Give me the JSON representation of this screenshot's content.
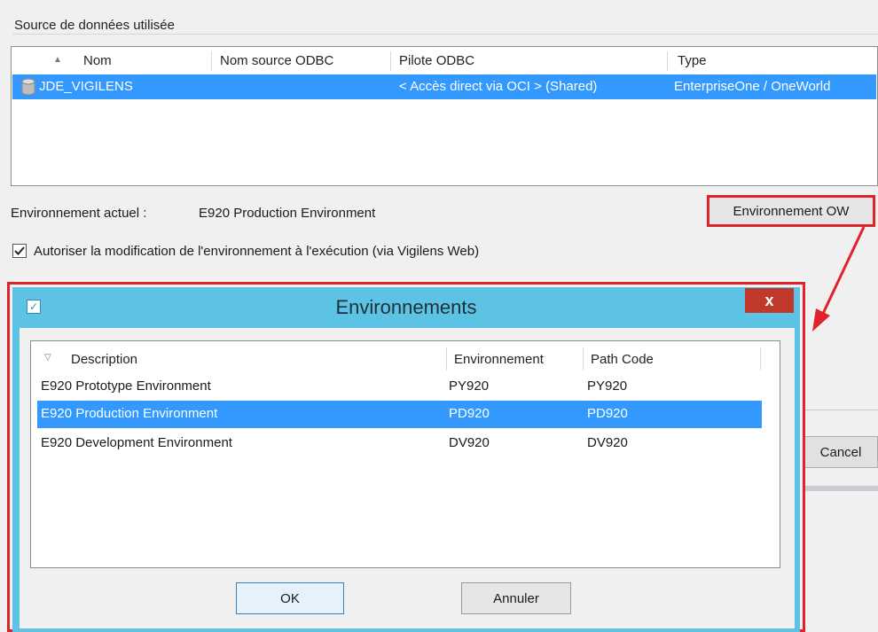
{
  "datasource": {
    "group_label": "Source de données utilisée",
    "columns": [
      "Nom",
      "Nom source ODBC",
      "Pilote ODBC",
      "Type"
    ],
    "rows": [
      {
        "name": "JDE_VIGILENS",
        "odbc_source": "",
        "driver": "< Accès direct via OCI > (Shared)",
        "type": "EnterpriseOne / OneWorld",
        "selected": true
      }
    ]
  },
  "environment": {
    "current_label": "Environnement actuel :",
    "current_value": "E920 Production Environment",
    "ow_button": "Environnement OW",
    "allow_change_label": "Autoriser la modification de l'environnement à l'exécution (via Vigilens Web)",
    "allow_change_checked": true
  },
  "background": {
    "cancel_button": "Cancel"
  },
  "dialog": {
    "title": "Environnements",
    "close_label": "x",
    "columns": [
      "Description",
      "Environnement",
      "Path Code"
    ],
    "rows": [
      {
        "description": "E920 Prototype Environment",
        "environment": "PY920",
        "path_code": "PY920"
      },
      {
        "description": "E920 Production Environment",
        "environment": "PD920",
        "path_code": "PD920",
        "selected": true
      },
      {
        "description": "E920 Development Environment",
        "environment": "DV920",
        "path_code": "DV920"
      }
    ],
    "ok_button": "OK",
    "cancel_button": "Annuler"
  },
  "colors": {
    "selection": "#3399ff",
    "highlight_red": "#e0222a",
    "dialog_frame": "#5cc3e4",
    "close_button": "#c0392b"
  },
  "icons": [
    "database-icon",
    "sort-asc-icon",
    "sort-desc-icon",
    "checkbox-check-icon",
    "dialog-app-icon",
    "close-icon",
    "annotation-arrow"
  ]
}
